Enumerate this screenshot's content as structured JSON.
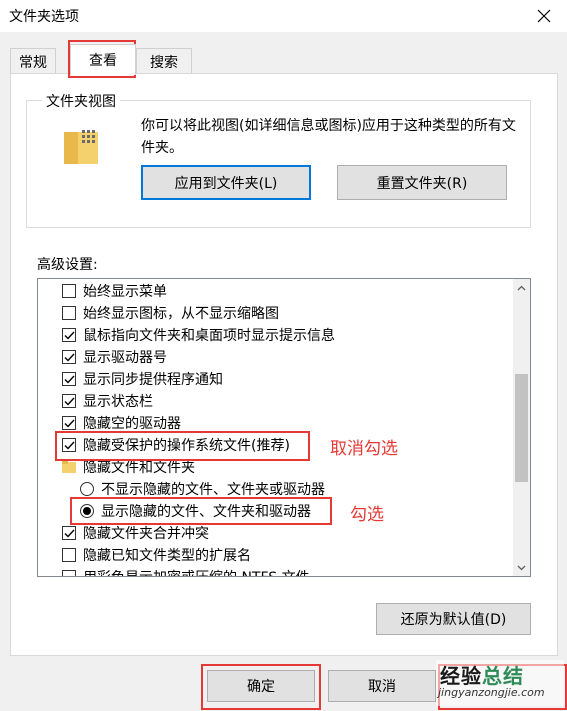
{
  "window": {
    "title": "文件夹选项"
  },
  "tabs": [
    {
      "label": "常规"
    },
    {
      "label": "查看"
    },
    {
      "label": "搜索"
    }
  ],
  "folder_views": {
    "legend": "文件夹视图",
    "description": "你可以将此视图(如详细信息或图标)应用于这种类型的所有文件夹。",
    "apply_button": "应用到文件夹(L)",
    "reset_button": "重置文件夹(R)"
  },
  "advanced": {
    "label": "高级设置:",
    "items": [
      {
        "type": "checkbox",
        "label": "始终显示菜单",
        "checked": false
      },
      {
        "type": "checkbox",
        "label": "始终显示图标，从不显示缩略图",
        "checked": false
      },
      {
        "type": "checkbox",
        "label": "鼠标指向文件夹和桌面项时显示提示信息",
        "checked": true
      },
      {
        "type": "checkbox",
        "label": "显示驱动器号",
        "checked": true
      },
      {
        "type": "checkbox",
        "label": "显示同步提供程序通知",
        "checked": true
      },
      {
        "type": "checkbox",
        "label": "显示状态栏",
        "checked": true
      },
      {
        "type": "checkbox",
        "label": "隐藏空的驱动器",
        "checked": true
      },
      {
        "type": "checkbox",
        "label": "隐藏受保护的操作系统文件(推荐)",
        "checked": true
      },
      {
        "type": "folder",
        "label": "隐藏文件和文件夹"
      },
      {
        "type": "radio",
        "label": "不显示隐藏的文件、文件夹或驱动器",
        "checked": false
      },
      {
        "type": "radio",
        "label": "显示隐藏的文件、文件夹和驱动器",
        "checked": true
      },
      {
        "type": "checkbox",
        "label": "隐藏文件夹合并冲突",
        "checked": true
      },
      {
        "type": "checkbox",
        "label": "隐藏已知文件类型的扩展名",
        "checked": false
      },
      {
        "type": "checkbox",
        "label": "用彩色显示加密或压缩的 NTFS 文件",
        "checked": false
      }
    ],
    "restore_button": "还原为默认值(D)"
  },
  "footer": {
    "ok_button": "确定",
    "cancel_button": "取消"
  },
  "annotations": {
    "uncheck": "取消勾选",
    "check": "勾选"
  },
  "watermark": {
    "main_plain": "经验",
    "main_accent": "总结",
    "url": "jingyanzongjie.com"
  },
  "colors": {
    "annotation_red": "#e53935",
    "focus_blue": "#0078d7",
    "watermark_green": "#2e8b57"
  }
}
